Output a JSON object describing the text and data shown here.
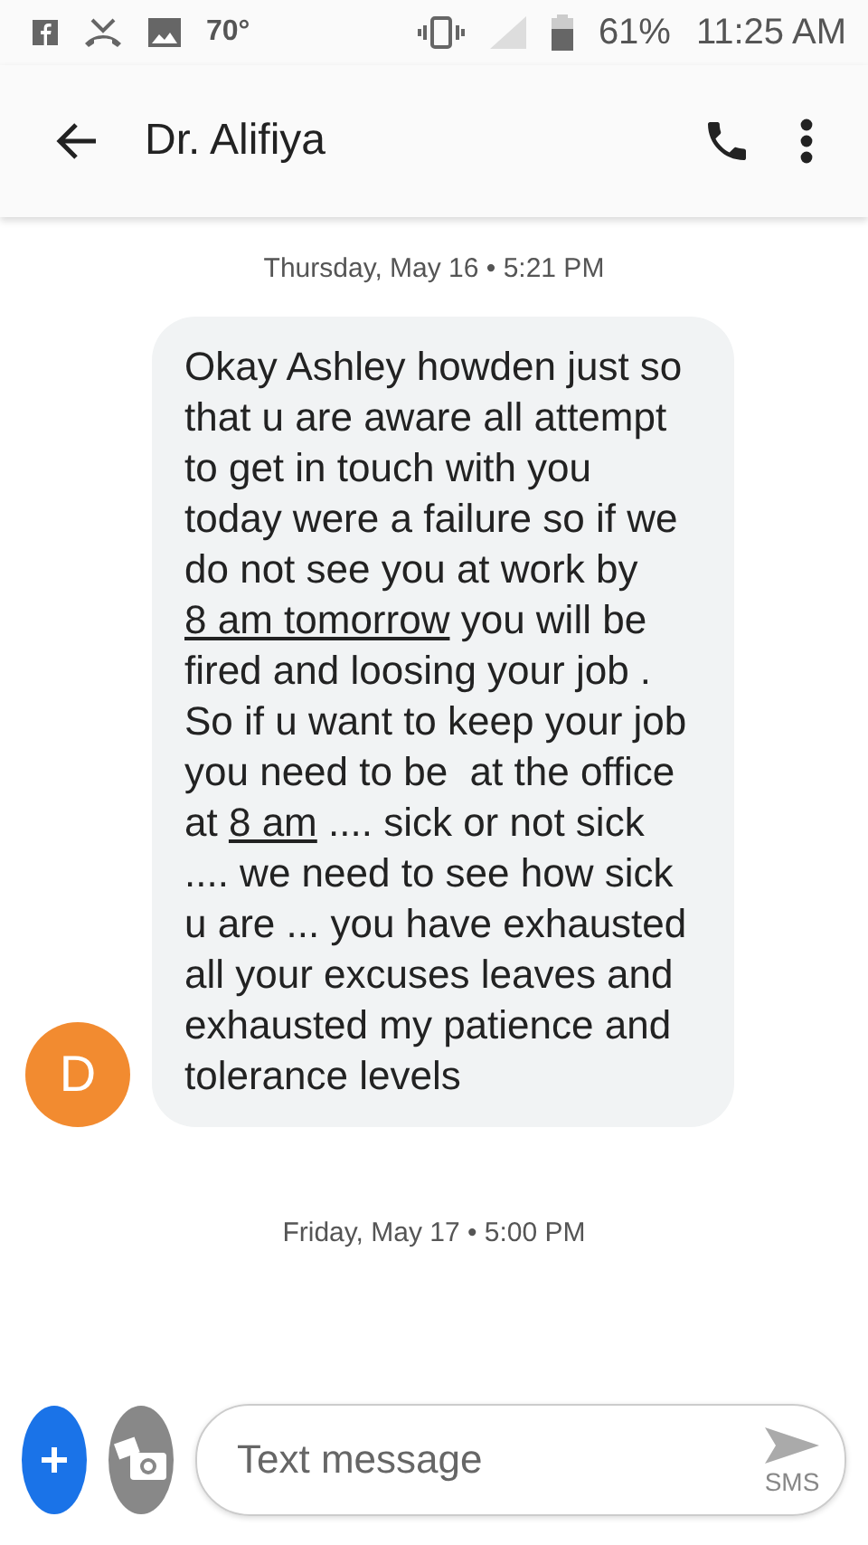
{
  "status_bar": {
    "temperature": "70°",
    "battery": "61%",
    "time": "11:25 AM"
  },
  "header": {
    "title": "Dr. Alifiya"
  },
  "messages": [
    {
      "date": "Thursday, May 16 • 5:21 PM",
      "avatar": "D",
      "color": "#f28b30",
      "segments": [
        {
          "text": "Okay Ashley howden just so that u are aware all attempt to get in touch with you today were a failure so if we do not see you at work by ",
          "link": false
        },
        {
          "text": "8 am tomorrow",
          "link": true
        },
        {
          "text": " you will be fired and loosing your job . So if u want to keep your job you need to be  at the office at ",
          "link": false
        },
        {
          "text": "8 am",
          "link": true
        },
        {
          "text": " .... sick or not sick .... we need to see how sick u are ... you have exhausted all your excuses leaves and exhausted my patience and tolerance levels",
          "link": false
        }
      ]
    }
  ],
  "next_date": "Friday, May 17 • 5:00 PM",
  "compose": {
    "placeholder": "Text message",
    "send_label": "SMS"
  }
}
